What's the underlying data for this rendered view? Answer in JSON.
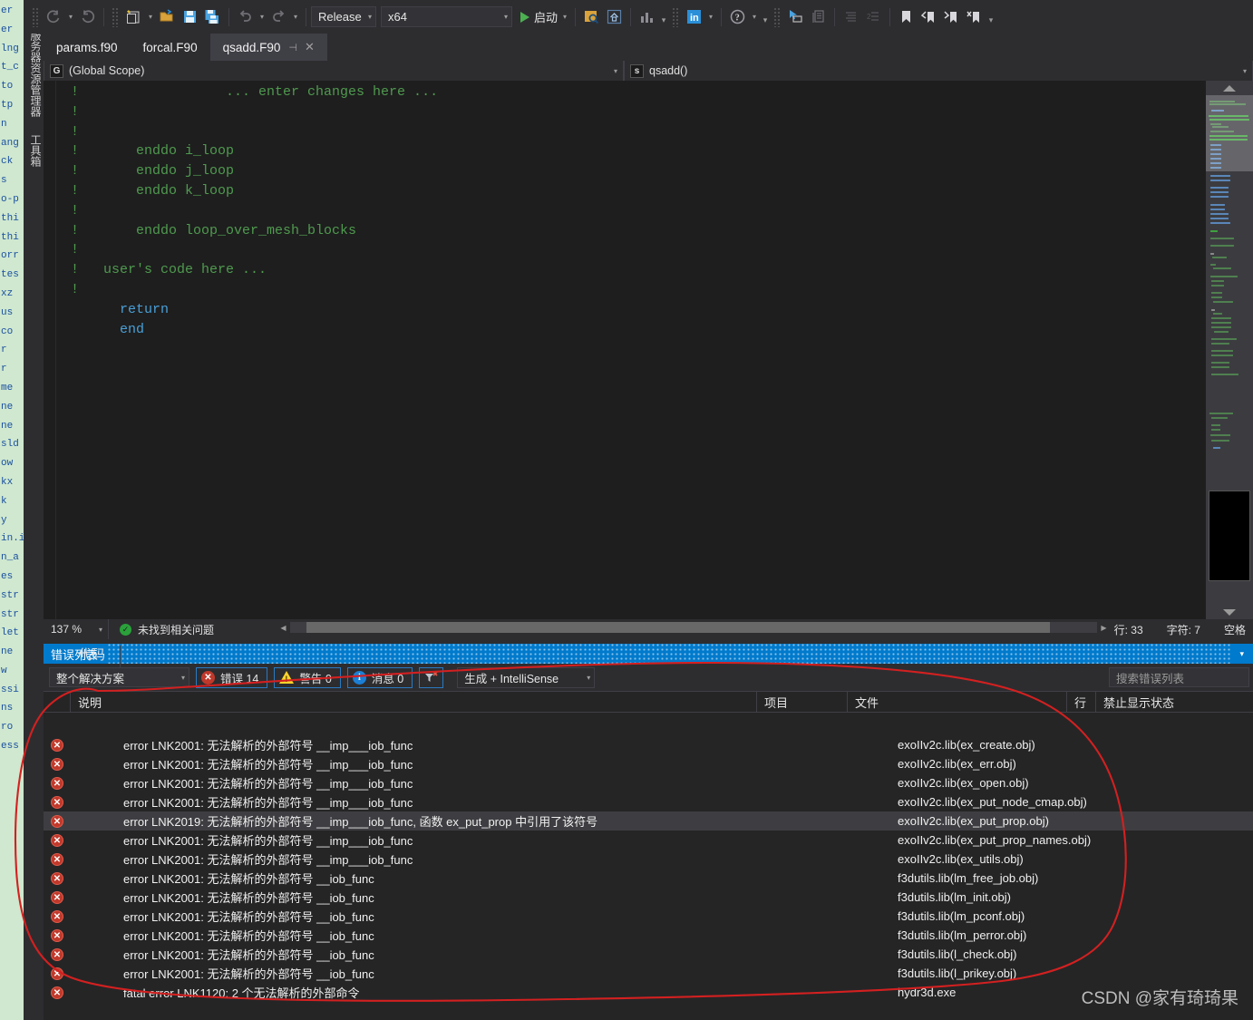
{
  "window": {
    "title_vtabs": [
      "服务器资源管理器",
      "工具箱"
    ]
  },
  "toolbar": {
    "config_value": "Release",
    "platform_value": "x64",
    "run_label": "启动",
    "icons": [
      "navigate-back-icon",
      "navigate-forward-icon",
      "new-item-icon",
      "open-file-icon",
      "save-icon",
      "save-all-icon",
      "undo-icon",
      "redo-icon",
      "find-in-files-icon",
      "home-icon",
      "performance-icon",
      "linkedin-icon",
      "help-icon",
      "pointer-select-icon",
      "copy-layout-icon",
      "indent-icon",
      "outdent-icon",
      "bookmark-icon",
      "prev-bookmark-icon",
      "next-bookmark-icon",
      "clear-bookmark-icon"
    ]
  },
  "tabs": [
    {
      "label": "params.f90",
      "active": false
    },
    {
      "label": "forcal.F90",
      "active": false
    },
    {
      "label": "qsadd.F90",
      "active": true
    }
  ],
  "navbar": {
    "left_icon": "G",
    "left_value": "(Global Scope)",
    "right_icon": "s",
    "right_value": "qsadd()"
  },
  "editor": {
    "lines": [
      {
        "t": "c",
        "text": "!                  ... enter changes here ..."
      },
      {
        "t": "c",
        "text": "!"
      },
      {
        "t": "c",
        "text": "!"
      },
      {
        "t": "c",
        "text": "!       enddo i_loop"
      },
      {
        "t": "c",
        "text": "!       enddo j_loop"
      },
      {
        "t": "c",
        "text": "!       enddo k_loop"
      },
      {
        "t": "c",
        "text": "!"
      },
      {
        "t": "c",
        "text": "!       enddo loop_over_mesh_blocks"
      },
      {
        "t": "c",
        "text": "!"
      },
      {
        "t": "c",
        "text": "!   user's code here ..."
      },
      {
        "t": "c",
        "text": "!"
      },
      {
        "t": "k",
        "text": "      return"
      },
      {
        "t": "k",
        "text": "      end"
      }
    ]
  },
  "editor_status": {
    "zoom": "137 %",
    "issue_status": "未找到相关问题",
    "line_label": "行: 33",
    "char_label": "字符: 7",
    "space_label": "空格"
  },
  "error_panel": {
    "title": "错误列表",
    "scope_filter": "整个解决方案",
    "error_badge": "错误 14",
    "warning_badge": "警告 0",
    "message_badge": "消息 0",
    "filter_icon": "filter-icon",
    "build_filter": "生成 + IntelliSense",
    "search_placeholder": "搜索错误列表",
    "columns": {
      "code": "代码",
      "description": "说明",
      "project": "项目",
      "file": "文件",
      "line": "行",
      "suppression": "禁止显示状态"
    },
    "rows": [
      {
        "icon": "error-icon",
        "code": "",
        "description": "error LNK2001: 无法解析的外部符号 __imp___iob_func",
        "project": "",
        "file": "exoIIv2c.lib(ex_create.obj)",
        "line": "",
        "suppression": "",
        "selected": false
      },
      {
        "icon": "error-icon",
        "code": "",
        "description": "error LNK2001: 无法解析的外部符号 __imp___iob_func",
        "project": "",
        "file": "exoIIv2c.lib(ex_err.obj)",
        "line": "",
        "suppression": "",
        "selected": false
      },
      {
        "icon": "error-icon",
        "code": "",
        "description": "error LNK2001: 无法解析的外部符号 __imp___iob_func",
        "project": "",
        "file": "exoIIv2c.lib(ex_open.obj)",
        "line": "",
        "suppression": "",
        "selected": false
      },
      {
        "icon": "error-icon",
        "code": "",
        "description": "error LNK2001: 无法解析的外部符号 __imp___iob_func",
        "project": "",
        "file": "exoIIv2c.lib(ex_put_node_cmap.obj)",
        "line": "",
        "suppression": "",
        "selected": false
      },
      {
        "icon": "error-icon",
        "code": "",
        "description": "error LNK2019: 无法解析的外部符号 __imp___iob_func, 函数 ex_put_prop 中引用了该符号",
        "project": "",
        "file": "exoIIv2c.lib(ex_put_prop.obj)",
        "line": "",
        "suppression": "",
        "selected": true
      },
      {
        "icon": "error-icon",
        "code": "",
        "description": "error LNK2001: 无法解析的外部符号 __imp___iob_func",
        "project": "",
        "file": "exoIIv2c.lib(ex_put_prop_names.obj)",
        "line": "",
        "suppression": "",
        "selected": false
      },
      {
        "icon": "error-icon",
        "code": "",
        "description": "error LNK2001: 无法解析的外部符号 __imp___iob_func",
        "project": "",
        "file": "exoIIv2c.lib(ex_utils.obj)",
        "line": "",
        "suppression": "",
        "selected": false
      },
      {
        "icon": "error-icon",
        "code": "",
        "description": "error LNK2001: 无法解析的外部符号 __iob_func",
        "project": "",
        "file": "f3dutils.lib(lm_free_job.obj)",
        "line": "",
        "suppression": "",
        "selected": false
      },
      {
        "icon": "error-icon",
        "code": "",
        "description": "error LNK2001: 无法解析的外部符号 __iob_func",
        "project": "",
        "file": "f3dutils.lib(lm_init.obj)",
        "line": "",
        "suppression": "",
        "selected": false
      },
      {
        "icon": "error-icon",
        "code": "",
        "description": "error LNK2001: 无法解析的外部符号 __iob_func",
        "project": "",
        "file": "f3dutils.lib(lm_pconf.obj)",
        "line": "",
        "suppression": "",
        "selected": false
      },
      {
        "icon": "error-icon",
        "code": "",
        "description": "error LNK2001: 无法解析的外部符号 __iob_func",
        "project": "",
        "file": "f3dutils.lib(lm_perror.obj)",
        "line": "",
        "suppression": "",
        "selected": false
      },
      {
        "icon": "error-icon",
        "code": "",
        "description": "error LNK2001: 无法解析的外部符号 __iob_func",
        "project": "",
        "file": "f3dutils.lib(l_check.obj)",
        "line": "",
        "suppression": "",
        "selected": false
      },
      {
        "icon": "error-icon",
        "code": "",
        "description": "error LNK2001: 无法解析的外部符号 __iob_func",
        "project": "",
        "file": "f3dutils.lib(l_prikey.obj)",
        "line": "",
        "suppression": "",
        "selected": false
      },
      {
        "icon": "error-icon",
        "code": "",
        "description": "fatal error LNK1120: 2 个无法解析的外部命令",
        "project": "",
        "file": "hydr3d.exe",
        "line": "",
        "suppression": "",
        "selected": false
      }
    ]
  },
  "annotation": {
    "shape": "hand-drawn-red-ellipse",
    "color": "#d32020"
  },
  "watermark": {
    "text": "CSDN @家有琦琦果"
  },
  "background_window": {
    "fragments": [
      "er",
      "er",
      "lng",
      "t_c",
      "to",
      "tp",
      "n",
      "ang",
      "ck",
      "s",
      "o-p",
      "thi",
      "thi",
      "orr",
      "tes",
      "xz",
      "us",
      "co",
      "r",
      "r",
      "me",
      "ne",
      "ne",
      "sld",
      "ow",
      "kx",
      "k",
      "y",
      "in.i",
      "n_a",
      "es",
      "str",
      "str",
      "let",
      "ne",
      "w",
      "ssi",
      "ns",
      "ro",
      "ess"
    ]
  },
  "colors": {
    "accent": "#007acc",
    "editor_bg": "#1e1e1e",
    "chrome_bg": "#2d2d30",
    "comment_green": "#4f9a4f",
    "keyword_blue": "#4a9fd8",
    "error_red": "#c0392b",
    "annotation_red": "#d32020"
  }
}
